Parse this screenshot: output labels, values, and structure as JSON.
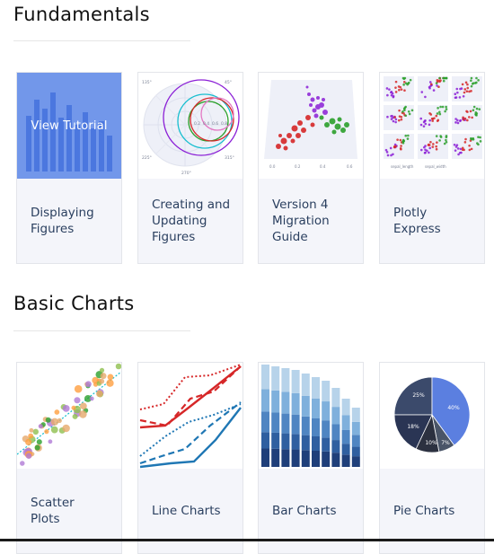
{
  "sections": [
    {
      "title": "Fundamentals",
      "cards": [
        {
          "label": "Displaying\nFigures",
          "overlay": "View Tutorial"
        },
        {
          "label": "Creating and\nUpdating\nFigures",
          "polar_labels": [
            "135°",
            "45°",
            "225°",
            "315°",
            "270°",
            "0.2",
            "0.4",
            "0.6",
            "0.8"
          ]
        },
        {
          "label": "Version 4\nMigration\nGuide"
        },
        {
          "label": "Plotly\nExpress",
          "axis_labels": [
            "sepal_length",
            "sepal_width"
          ]
        }
      ]
    },
    {
      "title": "Basic Charts",
      "cards": [
        {
          "label": "Scatter\nPlots"
        },
        {
          "label": "Line Charts"
        },
        {
          "label": "Bar Charts"
        },
        {
          "label": "Pie Charts",
          "pie_labels": [
            "25%",
            "40%",
            "18%",
            "10%",
            "7%"
          ]
        }
      ]
    }
  ],
  "colors": {
    "overlay": "#507de6",
    "card_bg": "#f4f5fa",
    "text": "#2a3f5f",
    "red": "#d62728",
    "blue": "#1f77b4",
    "green": "#2ca02c",
    "purple": "#8b1fd6",
    "teal": "#17becf"
  }
}
